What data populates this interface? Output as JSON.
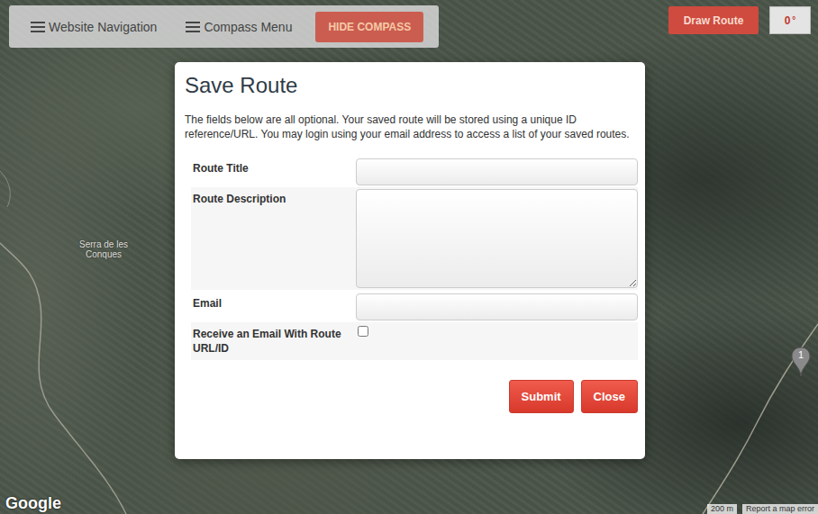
{
  "toolbar": {
    "items": [
      "Website Navigation",
      "Compass Menu"
    ],
    "hide_button": "HIDE COMPASS"
  },
  "top_right": {
    "draw_button": "Draw Route",
    "heading": "0",
    "heading_unit": "°"
  },
  "map": {
    "labels": [
      "Serra de les Conques"
    ],
    "marker": "1",
    "logo": "Google",
    "scale": "200 m",
    "report": "Report a map error"
  },
  "dialog": {
    "title": "Save Route",
    "description": "The fields below are all optional. Your saved route will be stored using a unique ID reference/URL. You may login using your email address to access a list of your saved routes.",
    "fields": [
      {
        "label": "Route Title",
        "kind": "text",
        "value": ""
      },
      {
        "label": "Route Description",
        "kind": "textarea",
        "value": ""
      },
      {
        "label": "Email",
        "kind": "text",
        "value": ""
      },
      {
        "label": "Receive an Email With Route URL/ID",
        "kind": "checkbox",
        "checked": false
      }
    ],
    "buttons": [
      "Submit",
      "Close"
    ]
  }
}
